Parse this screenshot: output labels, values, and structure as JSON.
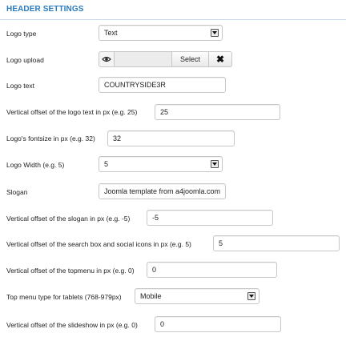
{
  "header": {
    "title": "HEADER SETTINGS"
  },
  "logo_type": {
    "label": "Logo type",
    "value": "Text"
  },
  "logo_upload": {
    "label": "Logo upload",
    "select_label": "Select",
    "clear_glyph": "✖"
  },
  "logo_text": {
    "label": "Logo text",
    "value": "COUNTRYSIDE3R"
  },
  "logo_text_offset": {
    "label": "Vertical offset of the logo text in px (e.g. 25)",
    "value": "25"
  },
  "logo_fontsize": {
    "label": "Logo's fontsize in px (e.g. 32)",
    "value": "32"
  },
  "logo_width": {
    "label": "Logo Width (e.g. 5)",
    "value": "5"
  },
  "slogan": {
    "label": "Slogan",
    "value": "Joomla template from a4joomla.com"
  },
  "slogan_offset": {
    "label": "Vertical offset of the slogan in px (e.g. -5)",
    "value": "-5"
  },
  "search_offset": {
    "label": "Vertical offset of the search box and social icons in px (e.g. 5)",
    "value": "5"
  },
  "topmenu_offset": {
    "label": "Vertical offset of the topmenu in px (e.g. 0)",
    "value": "0"
  },
  "tablet_menu_type": {
    "label": "Top menu type for tablets (768-979px)",
    "value": "Mobile"
  },
  "slideshow_offset": {
    "label": "Vertical offset of the slideshow in px (e.g. 0)",
    "value": "0"
  },
  "colors": {
    "header_text": "#2a7bc0",
    "header_rule": "#c9d9ea",
    "field_border": "#c7c7c7"
  },
  "icons": {
    "eye": "eye-icon",
    "clear": "close-icon",
    "dropdown": "chevron-down-icon"
  }
}
